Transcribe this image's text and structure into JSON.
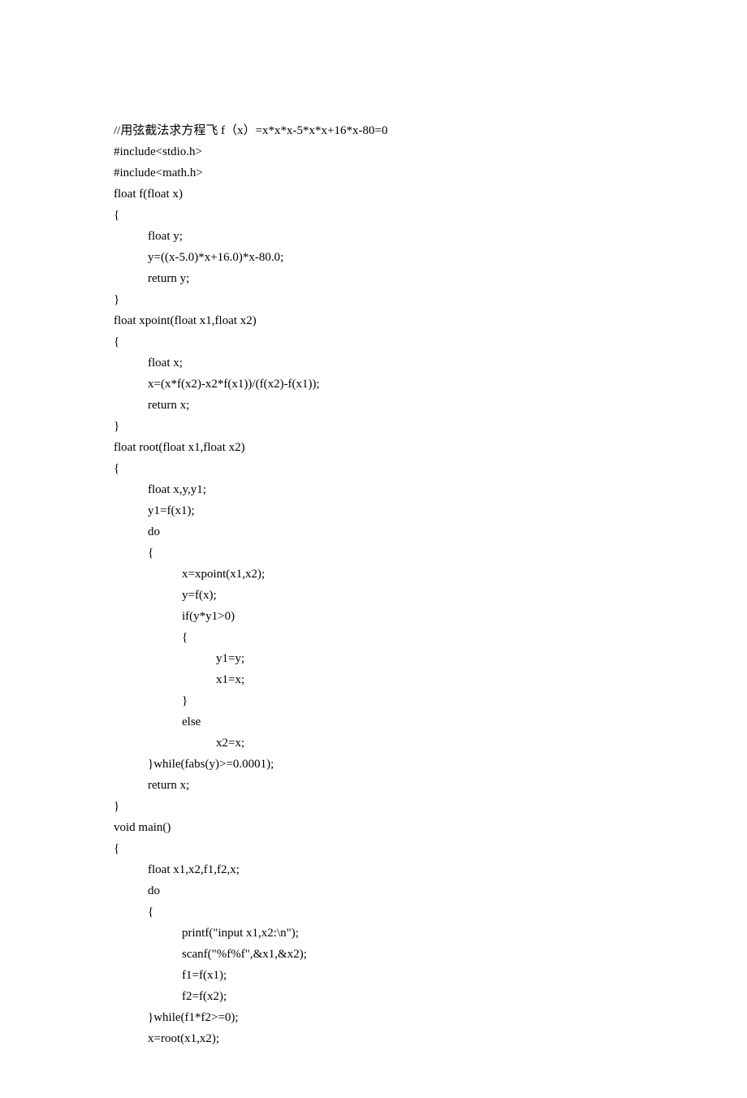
{
  "code": {
    "lines": [
      {
        "text": "//用弦截法求方程飞 f（x）=x*x*x-5*x*x+16*x-80=0",
        "indent": 0
      },
      {
        "text": "#include<stdio.h>",
        "indent": 0
      },
      {
        "text": "#include<math.h>",
        "indent": 0
      },
      {
        "text": "float f(float x)",
        "indent": 0
      },
      {
        "text": "{",
        "indent": 0
      },
      {
        "text": "float y;",
        "indent": 1
      },
      {
        "text": "y=((x-5.0)*x+16.0)*x-80.0;",
        "indent": 1
      },
      {
        "text": "return y;",
        "indent": 1
      },
      {
        "text": "}",
        "indent": 0
      },
      {
        "text": "float xpoint(float x1,float x2)",
        "indent": 0
      },
      {
        "text": "{",
        "indent": 0
      },
      {
        "text": "float x;",
        "indent": 1
      },
      {
        "text": "x=(x*f(x2)-x2*f(x1))/(f(x2)-f(x1));",
        "indent": 1
      },
      {
        "text": "return x;",
        "indent": 1
      },
      {
        "text": "}",
        "indent": 0
      },
      {
        "text": "float root(float x1,float x2)",
        "indent": 0
      },
      {
        "text": "{",
        "indent": 0
      },
      {
        "text": "float x,y,y1;",
        "indent": 1
      },
      {
        "text": "y1=f(x1);",
        "indent": 1
      },
      {
        "text": "do",
        "indent": 1
      },
      {
        "text": "{",
        "indent": 1
      },
      {
        "text": "x=xpoint(x1,x2);",
        "indent": 2
      },
      {
        "text": "y=f(x);",
        "indent": 2
      },
      {
        "text": "if(y*y1>0)",
        "indent": 2
      },
      {
        "text": "{",
        "indent": 2
      },
      {
        "text": "y1=y;",
        "indent": 3
      },
      {
        "text": "x1=x;",
        "indent": 3
      },
      {
        "text": "}",
        "indent": 2
      },
      {
        "text": "else",
        "indent": 2
      },
      {
        "text": "x2=x;",
        "indent": 3
      },
      {
        "text": "}while(fabs(y)>=0.0001);",
        "indent": 1
      },
      {
        "text": "return x;",
        "indent": 1
      },
      {
        "text": "}",
        "indent": 0
      },
      {
        "text": "void main()",
        "indent": 0
      },
      {
        "text": "{",
        "indent": 0
      },
      {
        "text": "float x1,x2,f1,f2,x;",
        "indent": 1
      },
      {
        "text": "do",
        "indent": 1
      },
      {
        "text": "{",
        "indent": 1
      },
      {
        "text": "printf(\"input x1,x2:\\n\");",
        "indent": 2
      },
      {
        "text": "scanf(\"%f%f\",&x1,&x2);",
        "indent": 2
      },
      {
        "text": "f1=f(x1);",
        "indent": 2
      },
      {
        "text": "f2=f(x2);",
        "indent": 2
      },
      {
        "text": "}while(f1*f2>=0);",
        "indent": 1
      },
      {
        "text": "x=root(x1,x2);",
        "indent": 1
      }
    ]
  }
}
